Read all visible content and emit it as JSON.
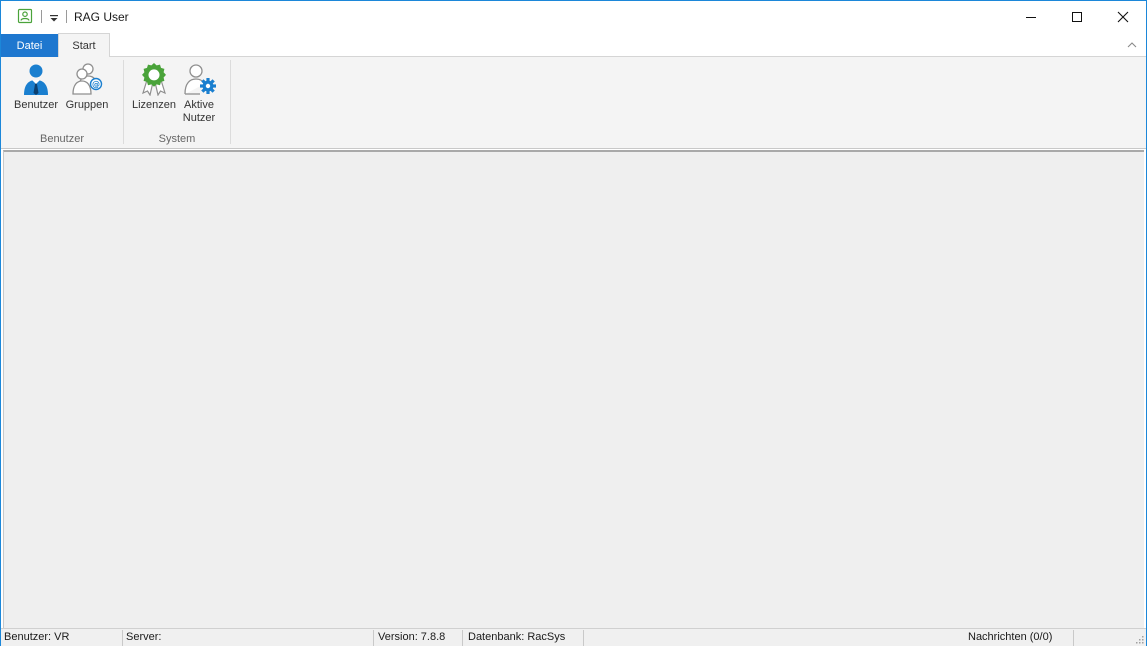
{
  "window": {
    "title": "RAG User"
  },
  "ribbon": {
    "tabs": [
      {
        "label": "Datei"
      },
      {
        "label": "Start"
      }
    ],
    "groups": [
      {
        "label": "Benutzer",
        "buttons": [
          {
            "label": "Benutzer",
            "icon": "user-icon"
          },
          {
            "label": "Gruppen",
            "icon": "user-group-icon"
          }
        ]
      },
      {
        "label": "System",
        "buttons": [
          {
            "label": "Lizenzen",
            "icon": "license-badge-icon"
          },
          {
            "label": "Aktive\nNutzer",
            "icon": "active-user-gear-icon"
          }
        ]
      }
    ]
  },
  "statusbar": {
    "user": "Benutzer: VR",
    "server": "Server:",
    "version": "Version: 7.8.8",
    "database": "Datenbank: RacSys",
    "messages": "Nachrichten (0/0)"
  },
  "colors": {
    "accent": "#1e77cf",
    "window_border": "#1c87d9",
    "ribbon_bg": "#f4f4f4",
    "workspace_bg": "#efefef",
    "license_green": "#4aa33a",
    "user_blue": "#1a7fcf"
  }
}
